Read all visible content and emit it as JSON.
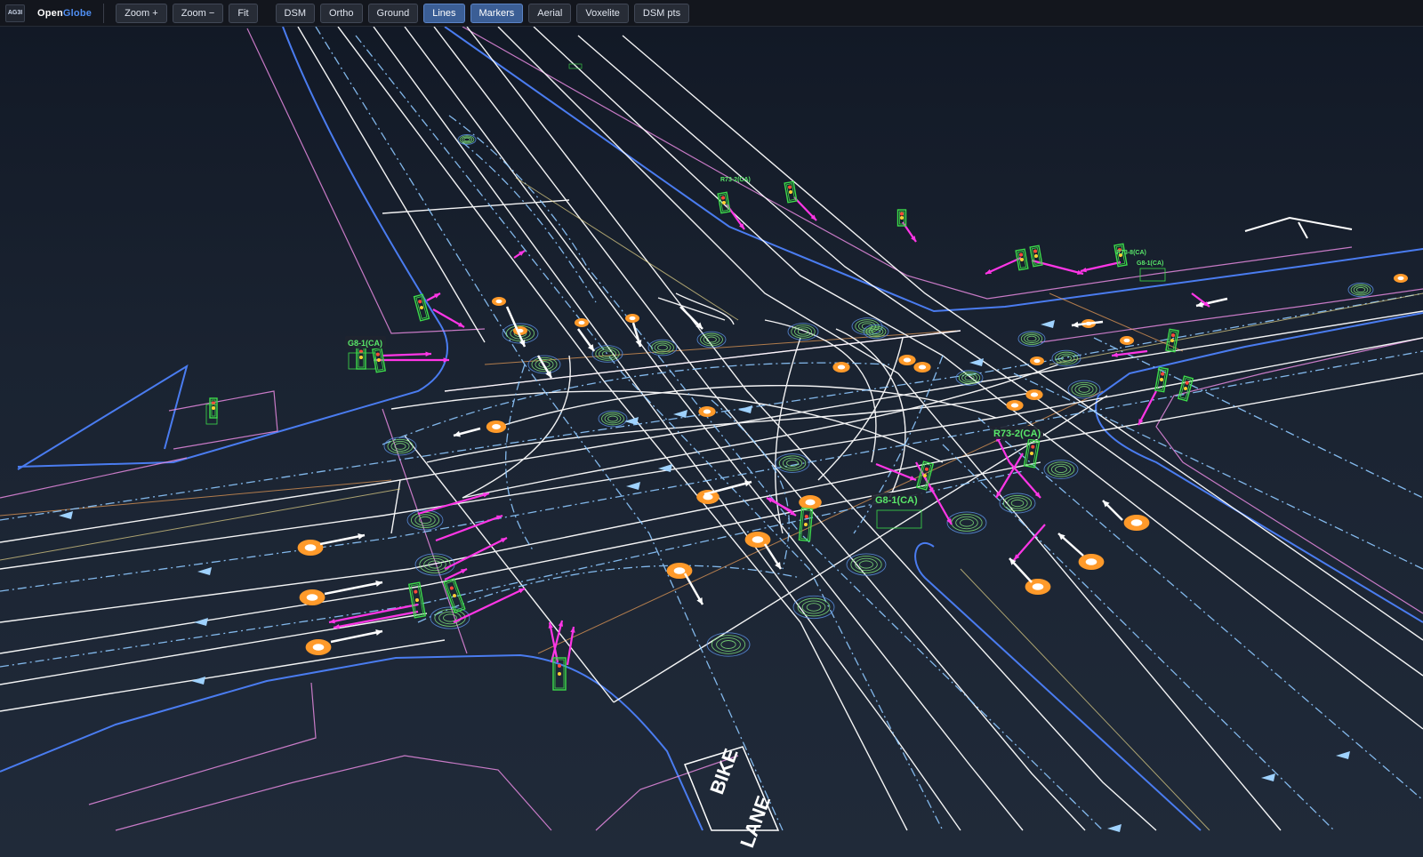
{
  "app": {
    "logo_text": "AG3I",
    "brand_prefix": "Open",
    "brand_suffix": "Globe"
  },
  "toolbar": {
    "zoom_in": "Zoom +",
    "zoom_out": "Zoom −",
    "fit": "Fit",
    "layers": [
      {
        "label": "DSM",
        "active": false
      },
      {
        "label": "Ortho",
        "active": false
      },
      {
        "label": "Ground",
        "active": false
      },
      {
        "label": "Lines",
        "active": true
      },
      {
        "label": "Markers",
        "active": true
      },
      {
        "label": "Aerial",
        "active": false
      },
      {
        "label": "Voxelite",
        "active": false
      },
      {
        "label": "DSM pts",
        "active": false
      }
    ]
  },
  "map": {
    "sign_labels": [
      "R73-2(CA)",
      "R73-8(CA)",
      "G8-1(CA)",
      "G8-1(CA)",
      "R73-2(CA)",
      "G8-1(CA)"
    ],
    "road_text": [
      "BIKE",
      "LANE"
    ],
    "colors": {
      "lane_line": "#ffffff",
      "centerline": "#8ec8ff",
      "curb": "#4a7cf0",
      "boundary": "#e68ae0",
      "signal": "#3cdc4a",
      "arrow_marker": "#ff36e6",
      "marker_point": "#ff9a2a",
      "ring": "#7fe07a"
    }
  }
}
